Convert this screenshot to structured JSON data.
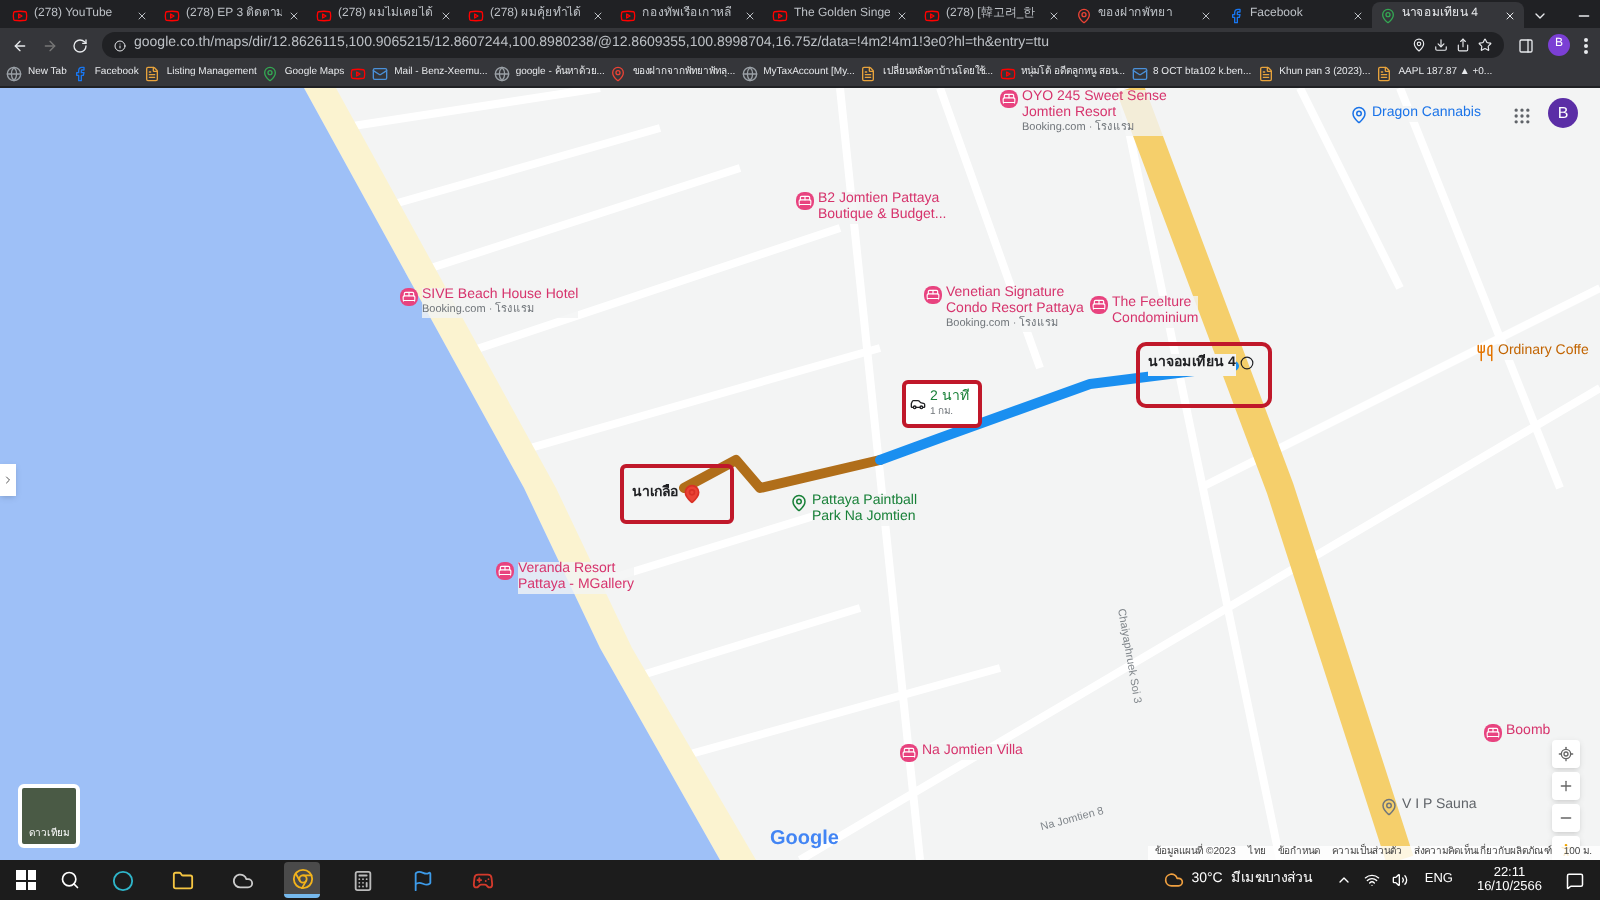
{
  "browser": {
    "tabs": [
      {
        "kind": "youtube",
        "title": "(278) YouTube",
        "selected": false
      },
      {
        "kind": "youtube",
        "title": "(278) EP 3 ติดตาม",
        "selected": false
      },
      {
        "kind": "youtube",
        "title": "(278) ผมไม่เคยได้",
        "selected": false
      },
      {
        "kind": "youtube",
        "title": "(278) ผมคุ้ยทำได้",
        "selected": false
      },
      {
        "kind": "youtube",
        "title": "กองทัพเรือเกาหลี",
        "selected": false
      },
      {
        "kind": "youtube",
        "title": "The Golden Singe",
        "selected": false
      },
      {
        "kind": "youtube",
        "title": "(278) [韓고려_한",
        "selected": false
      },
      {
        "kind": "pin",
        "title": "ของฝากพัทยา",
        "selected": false
      },
      {
        "kind": "facebook",
        "title": "Facebook",
        "selected": false
      },
      {
        "kind": "maps",
        "title": "นาจอมเทียน 4",
        "selected": true
      }
    ],
    "address": "google.co.th/maps/dir/12.8626115,100.9065215/12.8607244,100.8980238/@12.8609355,100.8998704,16.75z/data=!4m2!4m1!3e0?hl=th&entry=ttu",
    "profile": "B",
    "bookmarks": [
      {
        "kind": "globe",
        "label": "New Tab"
      },
      {
        "kind": "facebook",
        "label": "Facebook"
      },
      {
        "kind": "doc",
        "label": "Listing Management"
      },
      {
        "kind": "maps",
        "label": "Google Maps"
      },
      {
        "kind": "youtube"
      },
      {
        "kind": "mail",
        "label": "Mail - Benz-Xeemu..."
      },
      {
        "kind": "globe",
        "label": "google - ค้นหาด้วย..."
      },
      {
        "kind": "pin",
        "label": "ของฝากจากพัทยาพัทลุ..."
      },
      {
        "kind": "globe",
        "label": "MyTaxAccount [My..."
      },
      {
        "kind": "doc",
        "label": "เปลี่ยนหลังคาบ้านโดยใช้..."
      },
      {
        "kind": "youtube",
        "label": "หนุ่มโต้ อดีตลูกหนู สอน..."
      },
      {
        "kind": "mail",
        "label": "8 OCT bta102 k.ben..."
      },
      {
        "kind": "doc",
        "label": "Khun pan 3 (2023)..."
      },
      {
        "kind": "doc",
        "label": "AAPL 187.87 ▲ +0..."
      }
    ]
  },
  "map": {
    "avatar": "B",
    "places": [
      {
        "kind": "hotel",
        "lines": [
          "OYO 245 Sweet Sense",
          "Jomtien Resort"
        ],
        "note": "Booking.com · โรงแรม"
      },
      {
        "kind": "shop",
        "lines": [
          "Dragon Cannabis"
        ]
      },
      {
        "kind": "hotel",
        "lines": [
          "B2 Jomtien Pattaya",
          "Boutique & Budget..."
        ]
      },
      {
        "kind": "hotel",
        "lines": [
          "SIVE Beach House Hotel"
        ],
        "note": "Booking.com · โรงแรม"
      },
      {
        "kind": "hotel",
        "lines": [
          "Venetian Signature",
          "Condo Resort Pattaya"
        ],
        "note": "Booking.com · โรงแรม"
      },
      {
        "kind": "hotel",
        "lines": [
          "The Feelture",
          "Condominium"
        ]
      },
      {
        "kind": "food",
        "lines": [
          "Ordinary Coffe"
        ]
      },
      {
        "kind": "park",
        "lines": [
          "Pattaya Paintball",
          "Park Na Jomtien"
        ]
      },
      {
        "kind": "hotel",
        "lines": [
          "Veranda Resort",
          "Pattaya - MGallery"
        ]
      },
      {
        "kind": "hotel",
        "lines": [
          "Na Jomtien Villa"
        ]
      },
      {
        "kind": "other",
        "lines": [
          "V I P Sauna"
        ]
      },
      {
        "kind": "hotel",
        "lines": [
          "Boomb"
        ]
      }
    ],
    "streets": [
      "Na Jomtien 8",
      "Chaiyaphruek Soi 3"
    ],
    "route": {
      "start": "นาเกลือ",
      "end": "นาจอมเทียน 4",
      "duration": "2 นาที",
      "distance": "1 กม."
    },
    "layer_label": "ดาวเทียม",
    "logo": "Google",
    "footer": [
      "ข้อมูลแผนที่ ©2023",
      "ไทย",
      "ข้อกำหนด",
      "ความเป็นส่วนตัว",
      "ส่งความคิดเห็นเกี่ยวกับผลิตภัณฑ์",
      "100 ม."
    ]
  },
  "taskbar": {
    "apps": [
      {
        "kind": "edge",
        "selected": false
      },
      {
        "kind": "files",
        "selected": false
      },
      {
        "kind": "app",
        "selected": false
      },
      {
        "kind": "chrome",
        "selected": true
      },
      {
        "kind": "calculator",
        "selected": false
      },
      {
        "kind": "steam",
        "selected": false
      },
      {
        "kind": "game",
        "selected": false
      }
    ],
    "temp": "30°C",
    "weather": "มีเมฆบางส่วน",
    "lang": "ENG",
    "time": "22:11",
    "date": "16/10/2566"
  }
}
